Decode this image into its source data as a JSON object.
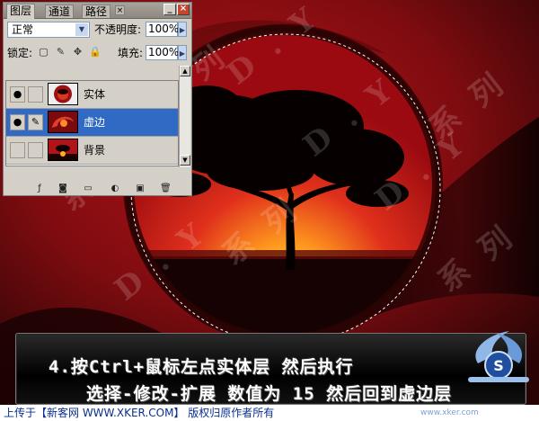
{
  "palette": {
    "tabs": [
      {
        "label": "图层",
        "active": true
      },
      {
        "label": "通道",
        "active": false
      },
      {
        "label": "路径",
        "active": false
      }
    ],
    "blend_mode": "正常",
    "opacity_label": "不透明度:",
    "opacity_value": "100%",
    "lock_label": "锁定:",
    "fill_label": "填充:",
    "fill_value": "100%",
    "layers": [
      {
        "name": "实体",
        "visible": true,
        "selected": false,
        "thumb": "red-circle"
      },
      {
        "name": "虚边",
        "visible": true,
        "selected": true,
        "thumb": "red-swirl"
      },
      {
        "name": "背景",
        "visible": false,
        "selected": false,
        "thumb": "sunset"
      }
    ],
    "colors": {
      "selected": "#316ac5",
      "panel": "#d4d0c8"
    }
  },
  "caption": {
    "line1": "4.按Ctrl+鼠标左点实体层 然后执行",
    "line2": "选择-修改-扩展 数值为 15  然后回到虚边层"
  },
  "footer": {
    "text": "上传于【新客网 WWW.XKER.COM】 版权归原作者所有",
    "sig": "www.xker.com"
  },
  "watermark": {
    "texts": [
      "系 列",
      "D . Y",
      "系 列",
      "D . Y",
      "系 列",
      "D . Y",
      "系 列",
      "D . Y",
      "系 列"
    ]
  },
  "logo": {
    "letter": "S"
  }
}
